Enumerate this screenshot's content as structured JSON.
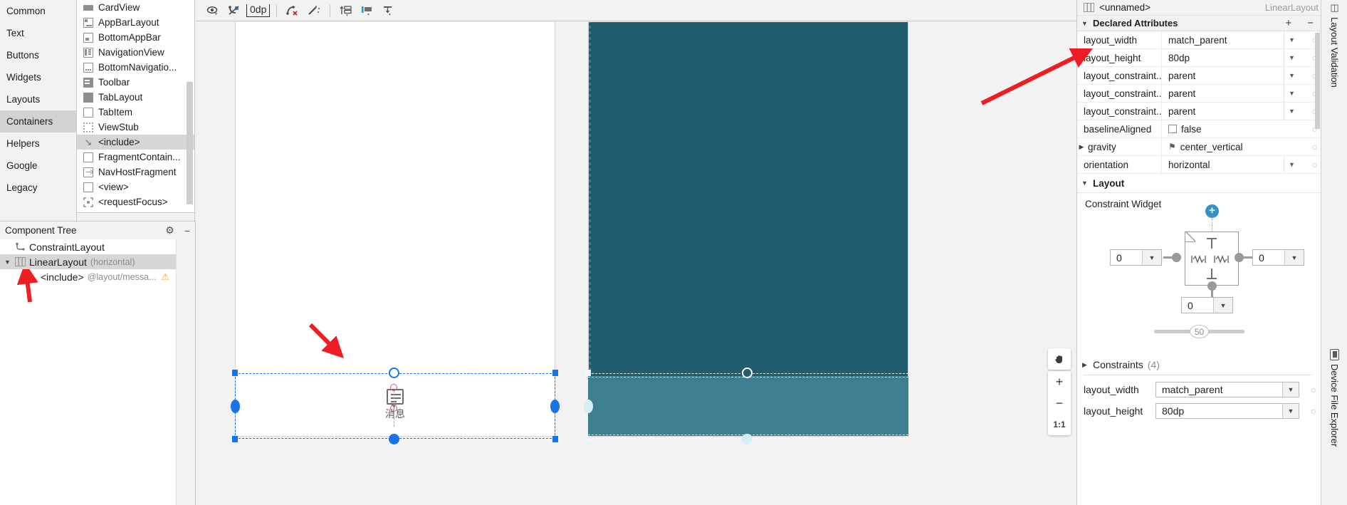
{
  "palette": {
    "categories": [
      {
        "label": "Common",
        "selected": false
      },
      {
        "label": "Text",
        "selected": false
      },
      {
        "label": "Buttons",
        "selected": false
      },
      {
        "label": "Widgets",
        "selected": false
      },
      {
        "label": "Layouts",
        "selected": false
      },
      {
        "label": "Containers",
        "selected": true
      },
      {
        "label": "Helpers",
        "selected": false
      },
      {
        "label": "Google",
        "selected": false
      },
      {
        "label": "Legacy",
        "selected": false
      }
    ],
    "items": [
      {
        "label": "CardView",
        "icon": "cardview-icon",
        "selected": false
      },
      {
        "label": "AppBarLayout",
        "icon": "appbarlayout-icon",
        "selected": false
      },
      {
        "label": "BottomAppBar",
        "icon": "bottomappbar-icon",
        "selected": false
      },
      {
        "label": "NavigationView",
        "icon": "navigationview-icon",
        "selected": false
      },
      {
        "label": "BottomNavigatio...",
        "icon": "bottomnavigation-icon",
        "selected": false
      },
      {
        "label": "Toolbar",
        "icon": "toolbar-icon",
        "selected": false
      },
      {
        "label": "TabLayout",
        "icon": "tablayout-icon",
        "selected": false
      },
      {
        "label": "TabItem",
        "icon": "tabitem-icon",
        "selected": false
      },
      {
        "label": "ViewStub",
        "icon": "viewstub-icon",
        "selected": false
      },
      {
        "label": "<include>",
        "icon": "include-icon",
        "selected": true
      },
      {
        "label": "FragmentContain...",
        "icon": "fragmentcontainer-icon",
        "selected": false
      },
      {
        "label": "NavHostFragment",
        "icon": "navhostfragment-icon",
        "selected": false
      },
      {
        "label": "<view>",
        "icon": "view-icon",
        "selected": false
      },
      {
        "label": "<requestFocus>",
        "icon": "requestfocus-icon",
        "selected": false
      }
    ]
  },
  "component_tree": {
    "title": "Component Tree",
    "gear_icon": "gear-icon",
    "minimize_icon": "minimize-icon",
    "rows": [
      {
        "label": "ConstraintLayout",
        "sub": "",
        "warning": "",
        "selected": false
      },
      {
        "label": "LinearLayout",
        "sub": "(horizontal)",
        "warning": "",
        "selected": true
      },
      {
        "label": "<include>",
        "sub": "@layout/messa...",
        "warning": "⚠",
        "selected": false
      }
    ]
  },
  "design_toolbar": {
    "buttons": [
      {
        "name": "view-options-icon",
        "glyph": "eye"
      },
      {
        "name": "toggle-constraints-icon",
        "glyph": "constraint-off"
      },
      {
        "name": "default-margin-value",
        "glyph": "0dp",
        "label": "0dp"
      },
      {
        "name": "clear-constraints-icon",
        "glyph": "clear"
      },
      {
        "name": "infer-constraints-icon",
        "glyph": "magic"
      },
      {
        "name": "guidelines-icon",
        "glyph": "guideline"
      },
      {
        "name": "align-icon",
        "glyph": "align"
      },
      {
        "name": "pack-icon",
        "glyph": "pack"
      }
    ],
    "help_label": "?"
  },
  "canvas": {
    "widget_label": "消息",
    "widget_icon": "message-bubble-icon",
    "pan_icon": "hand-pan-icon",
    "zoom_in": "+",
    "zoom_out": "−",
    "zoom_reset": "1:1",
    "design_bg": "#ffffff",
    "blueprint_bg": "#215d6e",
    "selection_color": "#1a73e8"
  },
  "attributes": {
    "component_name": "<unnamed>",
    "component_type": "LinearLayout",
    "component_icon": "linearlayout-icon",
    "declared_section": {
      "title": "Declared Attributes",
      "add_label": "+",
      "remove_label": "−",
      "rows": [
        {
          "key": "layout_width",
          "value": "match_parent",
          "control": "dropdown"
        },
        {
          "key": "layout_height",
          "value": "80dp",
          "control": "dropdown"
        },
        {
          "key": "layout_constraint...",
          "value": "parent",
          "control": "dropdown"
        },
        {
          "key": "layout_constraint...",
          "value": "parent",
          "control": "dropdown"
        },
        {
          "key": "layout_constraint...",
          "value": "parent",
          "control": "dropdown"
        },
        {
          "key": "baselineAligned",
          "value": "false",
          "control": "checkbox"
        },
        {
          "key": "gravity",
          "value": "center_vertical",
          "control": "flag",
          "expandable": true
        },
        {
          "key": "orientation",
          "value": "horizontal",
          "control": "dropdown"
        }
      ]
    },
    "layout_section": {
      "title": "Layout",
      "constraint_widget_label": "Constraint Widget",
      "margin_left": "0",
      "margin_right": "0",
      "margin_bottom": "0",
      "bias_value": "50",
      "add_constraint_label": "+"
    },
    "constraints_section": {
      "title": "Constraints",
      "count": "(4)"
    },
    "bottom_rows": [
      {
        "key": "layout_width",
        "value": "match_parent"
      },
      {
        "key": "layout_height",
        "value": "80dp"
      }
    ]
  },
  "right_strip": {
    "tabs": [
      {
        "label": "Layout Validation",
        "icon": "layout-validation-icon"
      },
      {
        "label": "Device File Explorer",
        "icon": "device-icon"
      }
    ]
  },
  "annotations": {
    "arrow_color": "#ee1d23",
    "arrows": [
      {
        "name": "arrow-to-linearlayout-tree"
      },
      {
        "name": "arrow-to-widget-canvas"
      },
      {
        "name": "arrow-to-layout-height-attr"
      }
    ]
  }
}
